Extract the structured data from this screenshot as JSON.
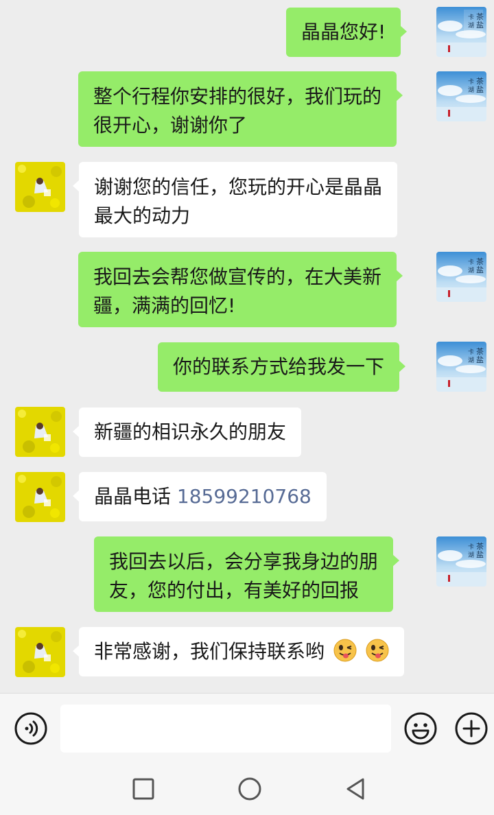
{
  "messages": [
    {
      "sender": "me",
      "text": "晶晶您好!"
    },
    {
      "sender": "me",
      "lines": [
        "整个行程你安排的很好，我们玩的",
        "很开心，谢谢你了"
      ]
    },
    {
      "sender": "them",
      "lines": [
        "谢谢您的信任，您玩的开心是晶晶",
        "最大的动力"
      ]
    },
    {
      "sender": "me",
      "lines": [
        "我回去会帮您做宣传的，在大美新",
        "疆，满满的回忆!"
      ]
    },
    {
      "sender": "me",
      "text": "你的联系方式给我发一下"
    },
    {
      "sender": "them",
      "text": "新疆的相识永久的朋友"
    },
    {
      "sender": "them",
      "prefix": "晶晶电话 ",
      "phone": "18599210768"
    },
    {
      "sender": "me",
      "lines": [
        "我回去以后，会分享我身边的朋",
        "友，您的付出，有美好的回报"
      ]
    },
    {
      "sender": "them",
      "text": "非常感谢，我们保持联系哟",
      "emojis": [
        "winking-tongue-emoji",
        "winking-tongue-emoji"
      ]
    }
  ],
  "my_avatar": {
    "caption": "茶卡盐湖",
    "icon": "salt-lake-photo"
  },
  "their_avatar": {
    "icon": "rapeseed-field-photo"
  },
  "input": {
    "value": "",
    "placeholder": ""
  },
  "colors": {
    "my_bubble": "#95ec69",
    "their_bubble": "#ffffff",
    "phone_link": "#576b95",
    "background": "#ededed"
  }
}
